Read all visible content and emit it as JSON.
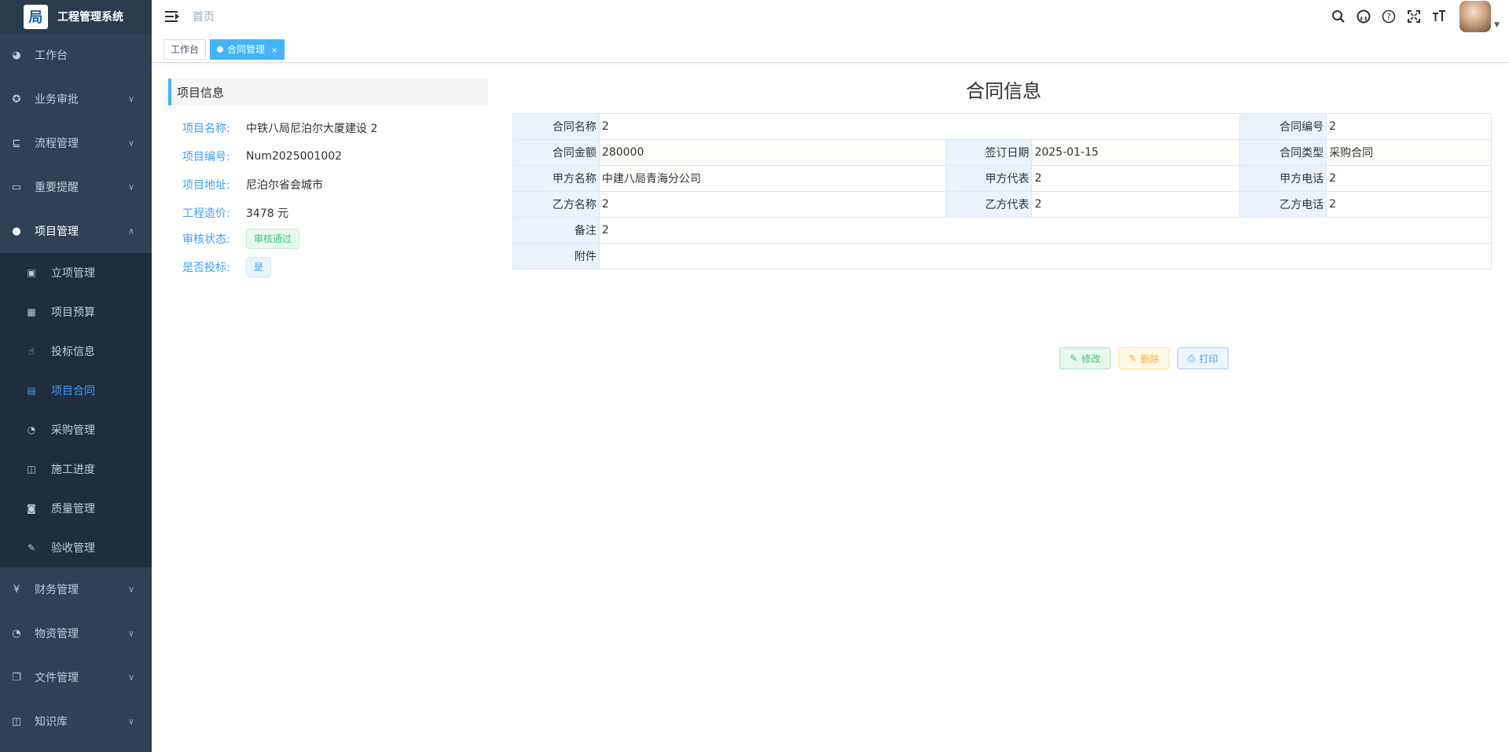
{
  "app": {
    "title": "工程管理系统",
    "logo_char": "局"
  },
  "sidebar": {
    "items": [
      {
        "label": "工作台",
        "icon": "dashboard-icon"
      },
      {
        "label": "业务审批",
        "icon": "approval-icon"
      },
      {
        "label": "流程管理",
        "icon": "flow-icon"
      },
      {
        "label": "重要提醒",
        "icon": "calendar-icon"
      },
      {
        "label": "项目管理",
        "icon": "globe-icon"
      }
    ],
    "sub_items": [
      {
        "label": "立项管理",
        "icon": "monitor-icon"
      },
      {
        "label": "项目预算",
        "icon": "table-icon"
      },
      {
        "label": "投标信息",
        "icon": "hand-icon"
      },
      {
        "label": "项目合同",
        "icon": "document-icon"
      },
      {
        "label": "采购管理",
        "icon": "palette-icon"
      },
      {
        "label": "施工进度",
        "icon": "columns-icon"
      },
      {
        "label": "质量管理",
        "icon": "quality-icon"
      },
      {
        "label": "验收管理",
        "icon": "edit-icon"
      }
    ],
    "bottom_items": [
      {
        "label": "财务管理",
        "icon": "yen-icon"
      },
      {
        "label": "物资管理",
        "icon": "palette-icon"
      },
      {
        "label": "文件管理",
        "icon": "files-icon"
      },
      {
        "label": "知识库",
        "icon": "book-icon"
      }
    ]
  },
  "navbar": {
    "breadcrumb": "首页"
  },
  "tags": {
    "home": "工作台",
    "active": "合同管理",
    "close": "×"
  },
  "project": {
    "panel_title": "项目信息",
    "rows": [
      {
        "label": "项目名称:",
        "value": "中铁八局尼泊尔大厦建设 2"
      },
      {
        "label": "项目编号:",
        "value": "Num2025001002"
      },
      {
        "label": "项目地址:",
        "value": "尼泊尔省会城市"
      },
      {
        "label": "工程造价:",
        "value": "3478 元"
      }
    ],
    "audit_label": "审核状态:",
    "audit_value": "审核通过",
    "bid_label": "是否投标:",
    "bid_value": "是"
  },
  "contract": {
    "title": "合同信息",
    "name_label": "合同名称",
    "name_value": "2",
    "code_label": "合同编号",
    "code_value": "2",
    "amount_label": "合同金额",
    "amount_value": "280000",
    "date_label": "签订日期",
    "date_value": "2025-01-15",
    "type_label": "合同类型",
    "type_value": "采购合同",
    "party_a_label": "甲方名称",
    "party_a_value": "中建八局青海分公司",
    "party_a_rep_label": "甲方代表",
    "party_a_rep_value": "2",
    "party_a_tel_label": "甲方电话",
    "party_a_tel_value": "2",
    "party_b_label": "乙方名称",
    "party_b_value": "2",
    "party_b_rep_label": "乙方代表",
    "party_b_rep_value": "2",
    "party_b_tel_label": "乙方电话",
    "party_b_tel_value": "2",
    "remark_label": "备注",
    "remark_value": "2",
    "attach_label": "附件",
    "attach_value": ""
  },
  "actions": {
    "edit": "修改",
    "delete": "删除",
    "print": "打印"
  }
}
